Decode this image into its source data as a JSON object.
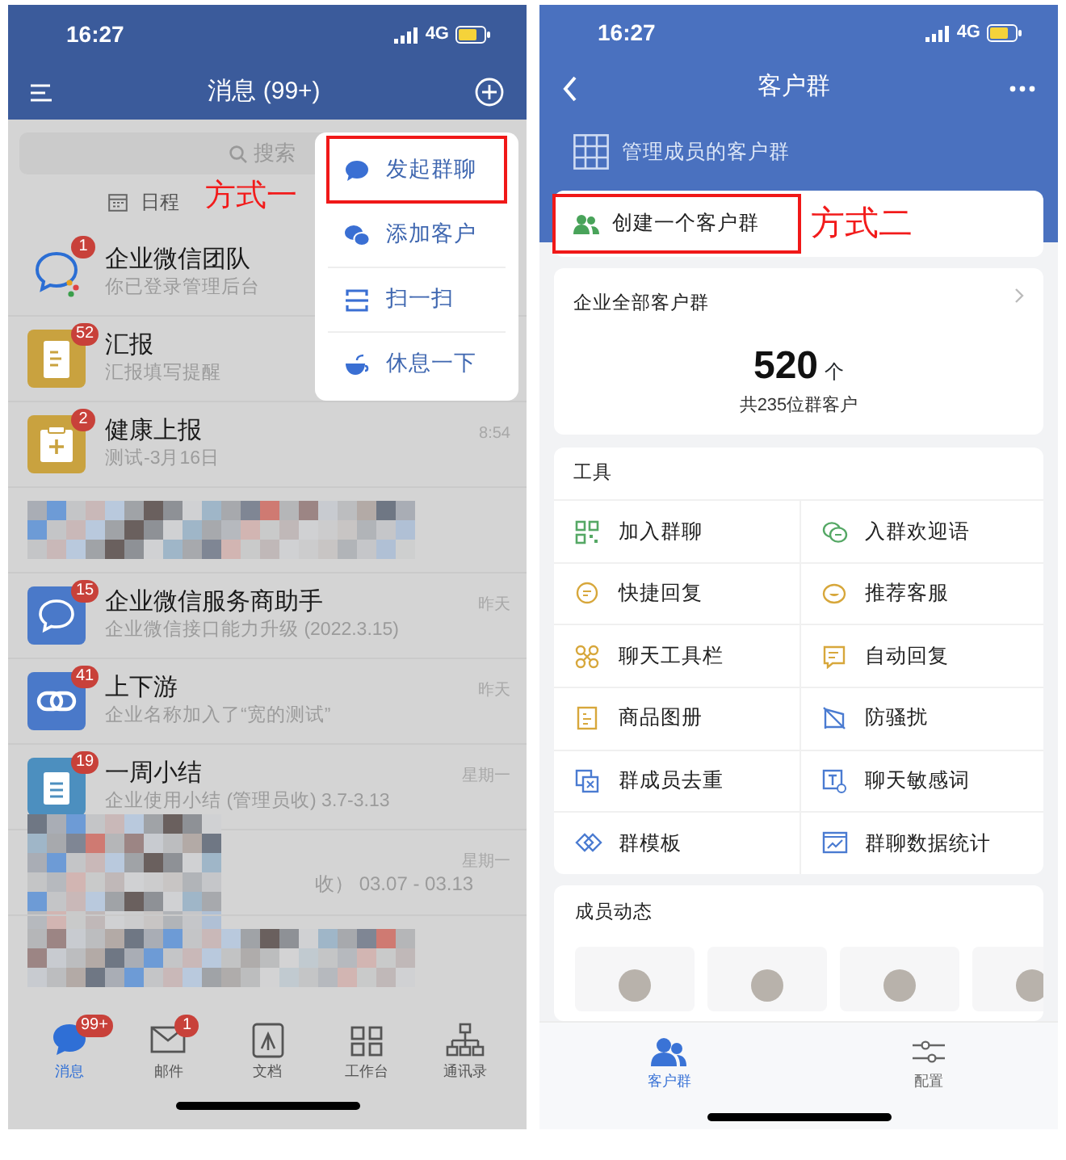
{
  "left_screen": {
    "status_bar": {
      "time": "16:27",
      "network": "4G"
    },
    "title": "消息 (99+)",
    "search": {
      "placeholder": "搜索"
    },
    "tabs": [
      {
        "label": "日程"
      }
    ],
    "chats": [
      {
        "kind": "chat",
        "name": "企业微信团队",
        "preview": "你已登录管理后台",
        "badge": "1"
      },
      {
        "kind": "chat",
        "name": "汇报",
        "preview": "汇报填写提醒",
        "badge": "52"
      },
      {
        "kind": "chat",
        "name": "健康上报",
        "preview": "测试-3月16日",
        "time": "8:54",
        "badge": "2"
      },
      {
        "kind": "blurred"
      },
      {
        "kind": "chat",
        "name": "企业微信服务商助手",
        "preview": "企业微信接口能力升级 (2022.3.15)",
        "time": "昨天",
        "badge": "15"
      },
      {
        "kind": "chat",
        "name": "上下游",
        "preview": "企业名称加入了“宽的测试”",
        "time": "昨天",
        "badge": "41"
      },
      {
        "kind": "chat",
        "name": "一周小结",
        "preview": "企业使用小结 (管理员收) 3.7-3.13",
        "time": "星期一",
        "badge": "19"
      },
      {
        "kind": "blurred",
        "preview": "收） 03.07 - 03.13",
        "time": "星期一"
      },
      {
        "kind": "blurred"
      }
    ],
    "menu": [
      {
        "label": "发起群聊",
        "annotated": true
      },
      {
        "label": "添加客户",
        "annotated": false
      },
      {
        "label": "扫一扫",
        "annotated": false
      },
      {
        "label": "休息一下",
        "annotated": false
      }
    ],
    "annotation": "方式一",
    "nav_tabs": [
      {
        "label": "消息",
        "badge": "99+",
        "selected": true
      },
      {
        "label": "邮件",
        "badge": "1",
        "selected": false
      },
      {
        "label": "文档",
        "selected": false
      },
      {
        "label": "工作台",
        "selected": false
      },
      {
        "label": "通讯录",
        "selected": false
      }
    ]
  },
  "right_screen": {
    "status_bar": {
      "time": "16:27",
      "network": "4G"
    },
    "title": "客户群",
    "header_link": "管理成员的客户群",
    "create_button": {
      "label": "创建一个客户群",
      "annotated": true
    },
    "annotation": "方式二",
    "summary": {
      "title": "企业全部客户群",
      "count": "520",
      "unit": "个",
      "caption": "共235位群客户"
    },
    "tools": {
      "title": "工具",
      "items": [
        "加入群聊",
        "入群欢迎语",
        "快捷回复",
        "推荐客服",
        "聊天工具栏",
        "自动回复",
        "商品图册",
        "防骚扰",
        "群成员去重",
        "聊天敏感词",
        "群模板",
        "群聊数据统计"
      ]
    },
    "member_activity": {
      "title": "成员动态"
    },
    "nav_tabs": [
      {
        "label": "客户群",
        "selected": true
      },
      {
        "label": "配置",
        "selected": false
      }
    ]
  }
}
